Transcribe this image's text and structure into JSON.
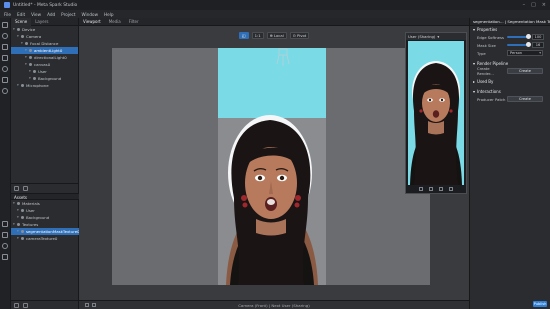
{
  "window": {
    "title": "Untitled* - Meta Spark Studio"
  },
  "menu": [
    "File",
    "Edit",
    "View",
    "Add",
    "Project",
    "Window",
    "Help"
  ],
  "scene_panel": {
    "tabs": [
      "Scene",
      "Layers"
    ],
    "items": [
      {
        "label": "Device",
        "indent": 0,
        "selected": false
      },
      {
        "label": "Camera",
        "indent": 1,
        "selected": false
      },
      {
        "label": "Focal Distance",
        "indent": 2,
        "selected": false
      },
      {
        "label": "ambientLight0",
        "indent": 3,
        "selected": true
      },
      {
        "label": "directionalLight0",
        "indent": 3,
        "selected": false
      },
      {
        "label": "canvas0",
        "indent": 3,
        "selected": false
      },
      {
        "label": "User",
        "indent": 4,
        "selected": false
      },
      {
        "label": "Background",
        "indent": 4,
        "selected": false
      },
      {
        "label": "Microphone",
        "indent": 1,
        "selected": false
      }
    ]
  },
  "assets_panel": {
    "title": "Assets",
    "items": [
      {
        "label": "Materials",
        "indent": 0,
        "selected": false
      },
      {
        "label": "User",
        "indent": 1,
        "selected": false
      },
      {
        "label": "Background",
        "indent": 1,
        "selected": false
      },
      {
        "label": "Textures",
        "indent": 0,
        "selected": false
      },
      {
        "label": "segmentationMaskTexture0",
        "indent": 1,
        "selected": true
      },
      {
        "label": "cameraTexture0",
        "indent": 1,
        "selected": false
      }
    ]
  },
  "viewport": {
    "tabs": [
      "Viewport",
      "Media",
      "Filter"
    ],
    "toolbar": [
      "1:1",
      "Local",
      "Pivot"
    ],
    "status": "Camera (Front) | Next User (Sharing)"
  },
  "simulator": {
    "device_label": "User (Sharing)"
  },
  "inspector": {
    "header": "segmentation... | Segmentation Mask Texture",
    "sections": {
      "properties": "Properties",
      "render_pipeline": "Render Pipeline",
      "used_by": "Used By",
      "interactions": "Interactions"
    },
    "props": {
      "edge_softness_label": "Edge Softness",
      "edge_softness_value": "100",
      "mask_size_label": "Mask Size",
      "mask_size_value": "16",
      "type_label": "Type",
      "type_value": "Person",
      "create_render_label": "Create Render...",
      "create_button": "Create",
      "producer_patch_label": "Producer Patch",
      "create_button_2": "Create"
    },
    "publish": "Publish"
  },
  "colors": {
    "accent": "#2f6fb7",
    "stage_bg": "#7adbe6"
  }
}
